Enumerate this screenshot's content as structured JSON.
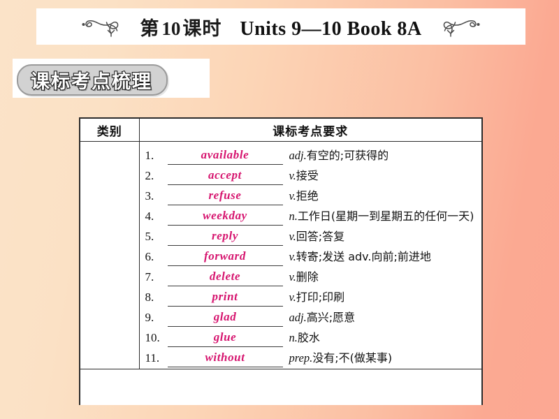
{
  "header": {
    "lesson_label": "第 10 课时",
    "lesson_cn_prefix": "第",
    "lesson_number": "10",
    "lesson_cn_suffix": "课时",
    "units_title": "Units 9—10 Book 8A",
    "left_ornament": "flourish-ornament-icon",
    "right_ornament": "flourish-ornament-icon"
  },
  "section_badge": {
    "label": "课标考点梳理"
  },
  "table": {
    "headers": {
      "kind": "类别",
      "requirement": "课标考点要求"
    },
    "kind_value": "",
    "rows": [
      {
        "num": "1.",
        "answer": "available",
        "pos": "adj.",
        "meaning": "有空的;可获得的"
      },
      {
        "num": "2.",
        "answer": "accept",
        "pos": "v.",
        "meaning": "接受"
      },
      {
        "num": "3.",
        "answer": "refuse",
        "pos": "v.",
        "meaning": "拒绝"
      },
      {
        "num": "4.",
        "answer": "weekday",
        "pos": "n.",
        "meaning": "工作日(星期一到星期五的任何一天)"
      },
      {
        "num": "5.",
        "answer": "reply",
        "pos": "v.",
        "meaning": "回答;答复"
      },
      {
        "num": "6.",
        "answer": "forward",
        "pos": "v.",
        "meaning": "转寄;发送 adv.向前;前进地"
      },
      {
        "num": "7.",
        "answer": "delete",
        "pos": "v.",
        "meaning": "删除"
      },
      {
        "num": "8.",
        "answer": "print",
        "pos": "v.",
        "meaning": "打印;印刷"
      },
      {
        "num": "9.",
        "answer": "glad",
        "pos": "adj.",
        "meaning": "高兴;愿意"
      },
      {
        "num": "10.",
        "answer": "glue",
        "pos": "n.",
        "meaning": "胶水"
      },
      {
        "num": "11.",
        "answer": "without",
        "pos": "prep.",
        "meaning": "没有;不(做某事)"
      }
    ]
  },
  "colors": {
    "answer_pink": "#d6156f",
    "background_left": "#fbe3c8",
    "background_right": "#fca893",
    "badge_fill": "#d2d2d2",
    "table_border": "#2b2b2b"
  }
}
